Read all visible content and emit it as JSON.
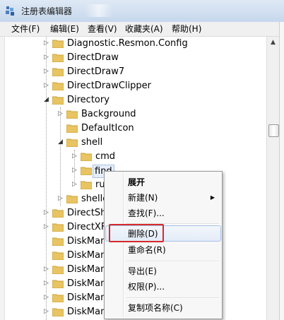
{
  "window": {
    "title": "注册表编辑器"
  },
  "menubar": [
    {
      "label": "文件(F)"
    },
    {
      "label": "编辑(E)"
    },
    {
      "label": "查看(V)"
    },
    {
      "label": "收藏夹(A)"
    },
    {
      "label": "帮助(H)"
    }
  ],
  "tree": {
    "rows": [
      {
        "label": "Diagnostic.Resmon.Config",
        "expander": "▷"
      },
      {
        "label": "DirectDraw",
        "expander": "▷"
      },
      {
        "label": "DirectDraw7",
        "expander": "▷"
      },
      {
        "label": "DirectDrawClipper",
        "expander": "▷"
      },
      {
        "label": "Directory",
        "expander": "◢"
      },
      {
        "label": "Background",
        "expander": "▷"
      },
      {
        "label": "DefaultIcon",
        "expander": ""
      },
      {
        "label": "shell",
        "expander": "◢"
      },
      {
        "label": "cmd",
        "expander": "▷"
      },
      {
        "label": "find",
        "expander": "▷"
      },
      {
        "label": "ru",
        "expander": "▷"
      },
      {
        "label": "shelle",
        "expander": "▷"
      },
      {
        "label": "DirectSho",
        "expander": "▷"
      },
      {
        "label": "DirectXFi",
        "expander": "▷"
      },
      {
        "label": "DiskMan",
        "expander": ""
      },
      {
        "label": "DiskMan",
        "expander": ""
      },
      {
        "label": "DiskMan",
        "expander": "▷"
      },
      {
        "label": "DiskMan",
        "expander": "▷"
      },
      {
        "label": "DiskMan",
        "expander": "▷"
      },
      {
        "label": "DiskMan",
        "expander": "▷"
      }
    ]
  },
  "context_menu": {
    "items": [
      {
        "label": "展开",
        "bold": true
      },
      {
        "label": "新建(N)",
        "submenu": "▶"
      },
      {
        "label": "查找(F)..."
      },
      {
        "label": "删除(D)"
      },
      {
        "label": "重命名(R)"
      },
      {
        "label": "导出(E)"
      },
      {
        "label": "权限(P)..."
      },
      {
        "label": "复制项名称(C)"
      }
    ]
  },
  "colors": {
    "highlight_box": "#d62a2a",
    "folder": "#e8c462"
  }
}
